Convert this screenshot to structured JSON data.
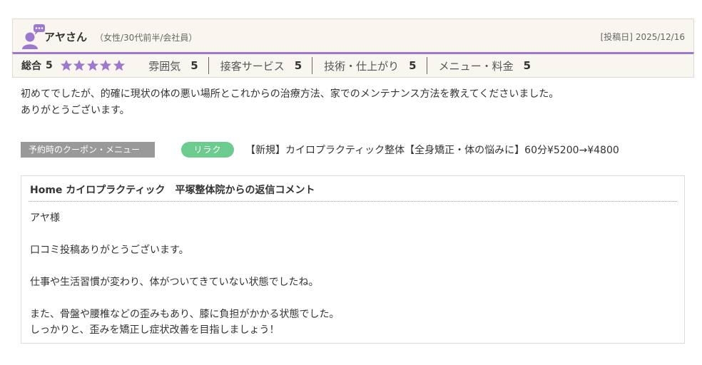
{
  "reviewer": {
    "name": "アヤさん",
    "meta": "（女性/30代前半/会社員）",
    "date_label": "[投稿日]",
    "date": "2025/12/16"
  },
  "rating": {
    "overall_label": "総合",
    "overall_score": "5",
    "stars": 5,
    "star_color": "#9c78cf",
    "categories": [
      {
        "label": "雰囲気",
        "score": "5"
      },
      {
        "label": "接客サービス",
        "score": "5"
      },
      {
        "label": "技術・仕上がり",
        "score": "5"
      },
      {
        "label": "メニュー・料金",
        "score": "5"
      }
    ]
  },
  "review": {
    "lines": [
      "初めてでしたが、的確に現状の体の悪い場所とこれからの治療方法、家でのメンテナンス方法を教えてくださいました。",
      "ありがとうございます。"
    ]
  },
  "coupon": {
    "tag": "予約時のクーポン・メニュー",
    "category": "リラク",
    "name": "【新規】カイロプラクティック整体【全身矯正・体の悩みに】60分¥5200→¥4800"
  },
  "reply": {
    "title": "Home カイロプラクティック　平塚整体院からの返信コメント",
    "lines": [
      "アヤ様",
      "",
      "口コミ投稿ありがとうございます。",
      "",
      "仕事や生活習慣が変わり、体がついてきていない状態でしたね。",
      "",
      "また、骨盤や腰椎などの歪みもあり、膝に負担がかかる状態でした。",
      "しっかりと、歪みを矯正し症状改善を目指しましょう！"
    ]
  },
  "colors": {
    "accent": "#9c78cf",
    "pill": "#6ccc8f",
    "tag": "#999999",
    "header_bg": "#f8f6ef"
  }
}
